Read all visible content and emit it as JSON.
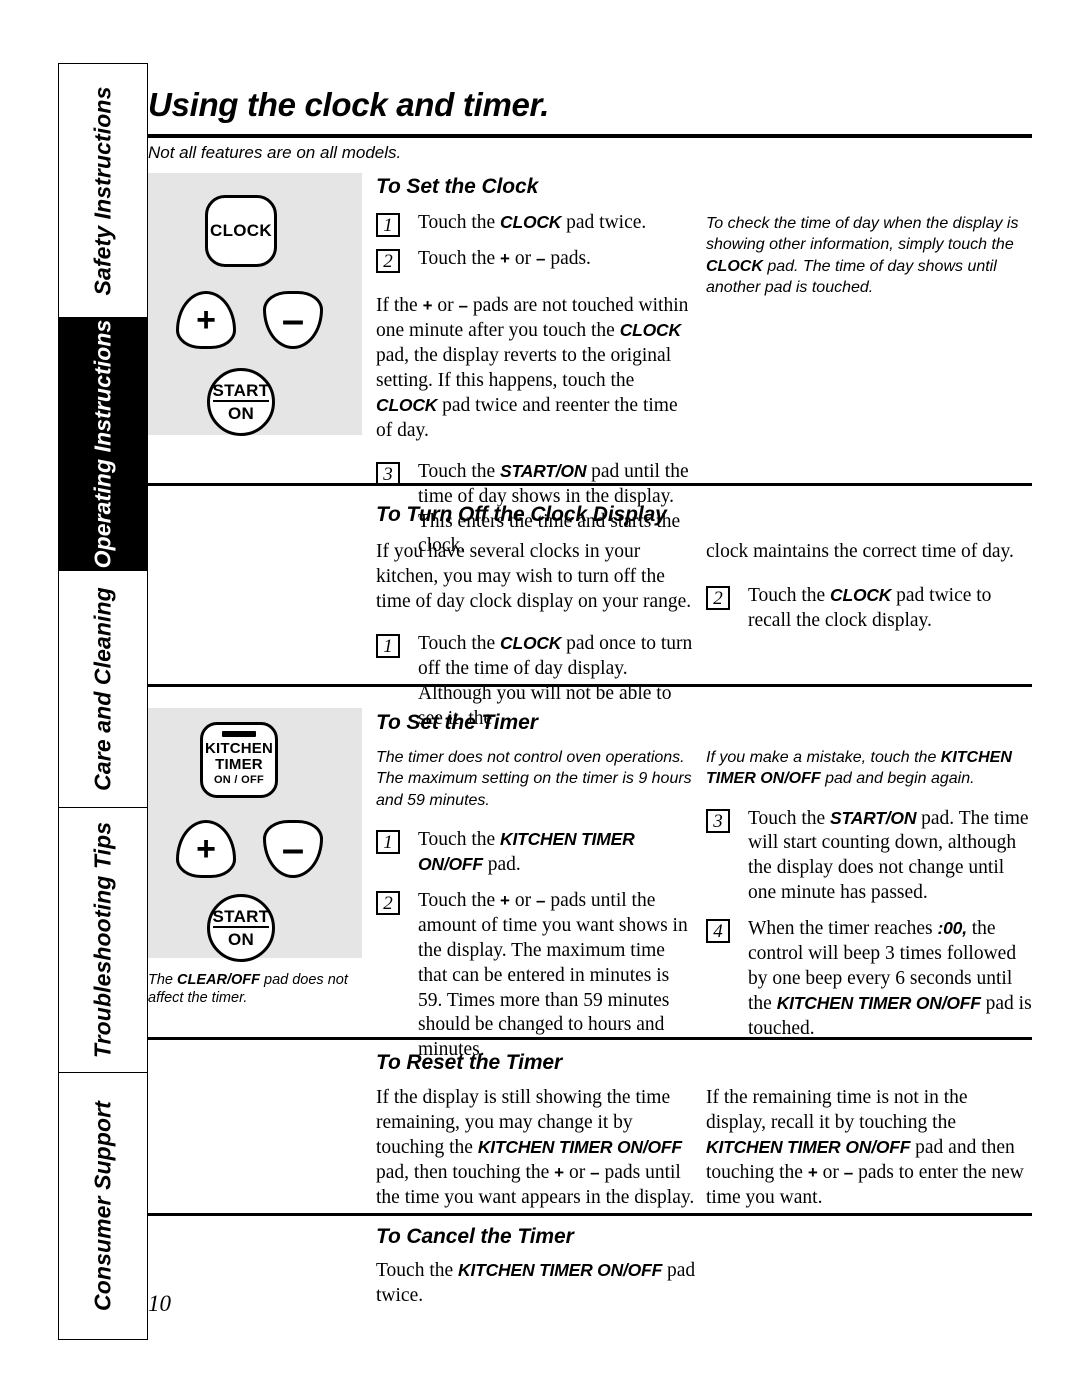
{
  "sidebar": {
    "tabs": [
      {
        "label": "Safety Instructions",
        "active": false
      },
      {
        "label": "Operating Instructions",
        "active": true
      },
      {
        "label": "Care and Cleaning",
        "active": false
      },
      {
        "label": "Troubleshooting Tips",
        "active": false
      },
      {
        "label": "Consumer Support",
        "active": false
      }
    ]
  },
  "page": {
    "title": "Using the clock and timer.",
    "subtitle": "Not all features are on all models.",
    "number": "10"
  },
  "panels": {
    "clock": {
      "clock_pad": "CLOCK",
      "plus": "+",
      "minus": "–",
      "start_line1": "START",
      "start_line2": "ON"
    },
    "timer": {
      "kt_line1": "KITCHEN",
      "kt_line2": "TIMER",
      "kt_line3": "ON / OFF",
      "plus": "+",
      "minus": "–",
      "start_line1": "START",
      "start_line2": "ON",
      "caption_pre": "The ",
      "caption_bold": "CLEAR/OFF",
      "caption_post": " pad does not affect the timer."
    }
  },
  "sections": {
    "set_clock": {
      "heading": "To Set the Clock",
      "steps": [
        {
          "num": "1",
          "text_parts": [
            "Touch the ",
            "CLOCK",
            " pad twice."
          ]
        },
        {
          "num": "2",
          "text_parts": [
            "Touch the ",
            "+",
            " or ",
            "–",
            " pads."
          ]
        }
      ],
      "body": "If the + or – pads are not touched within one minute after you touch the CLOCK pad, the display reverts to the original setting. If this happens, touch the CLOCK pad twice and reenter the time of day.",
      "step3": {
        "num": "3",
        "text": "Touch the START/ON pad until the time of day shows in the display. This enters the time and starts the clock."
      },
      "note": "To check the time of day when the display is showing other information, simply touch the CLOCK pad. The time of day shows until another pad is touched.",
      "note_bold": "CLOCK"
    },
    "turn_off_clock": {
      "heading": "To Turn Off the Clock Display",
      "intro": "If you have several clocks in your kitchen, you may wish to turn off the time of day clock display on your range.",
      "step1": {
        "num": "1",
        "text": "Touch the CLOCK pad once to turn off the time of day display. Although you will not be able to see it, the"
      },
      "right_continuation": "clock maintains the correct time of day.",
      "step2": {
        "num": "2",
        "text": "Touch the CLOCK pad twice to recall the clock display."
      }
    },
    "set_timer": {
      "heading": "To Set the Timer",
      "note_left": "The timer does not control oven operations. The maximum setting on the timer is 9 hours and 59 minutes.",
      "step1": {
        "num": "1",
        "text": "Touch the KITCHEN TIMER ON/OFF pad."
      },
      "step2": {
        "num": "2",
        "text": "Touch the + or – pads until the amount of time you want shows in the display. The maximum time that can be entered in minutes is 59. Times more than 59 minutes should be changed to hours and minutes."
      },
      "note_right": "If you make a mistake, touch the KITCHEN TIMER ON/OFF pad and begin again.",
      "step3": {
        "num": "3",
        "text": "Touch the START/ON pad. The time will start counting down, although the display does not change until one minute has passed."
      },
      "step4": {
        "num": "4",
        "text": "When the timer reaches :00, the control will beep 3 times followed by one beep every 6 seconds until the KITCHEN TIMER ON/OFF pad is touched."
      },
      "timer_value": ":00"
    },
    "reset_timer": {
      "heading": "To Reset the Timer",
      "left": "If the display is still showing the time remaining, you may change it by touching the KITCHEN TIMER ON/OFF pad, then touching the + or – pads until the time you want appears in the display.",
      "right": "If the remaining time is not in the display, recall it by touching the KITCHEN TIMER ON/OFF pad and then touching the + or – pads to enter the new time you want."
    },
    "cancel_timer": {
      "heading": "To Cancel the Timer",
      "body": "Touch the KITCHEN TIMER ON/OFF pad twice."
    }
  },
  "pad_names": {
    "clock": "CLOCK",
    "start_on": "START/ON",
    "kitchen_timer_onoff": "KITCHEN TIMER ON/OFF",
    "kitchen_timer": "KITCHEN TIMER",
    "onoff": "ON/OFF",
    "clear_off": "CLEAR/OFF",
    "kitchen": "KITCHEN",
    "timer_onoff": "TIMER ON/OFF",
    "plus": "+",
    "minus": "–"
  },
  "colors": {
    "panel_background": "#e5e5e5",
    "active_tab": "#000000",
    "text": "#000000"
  }
}
